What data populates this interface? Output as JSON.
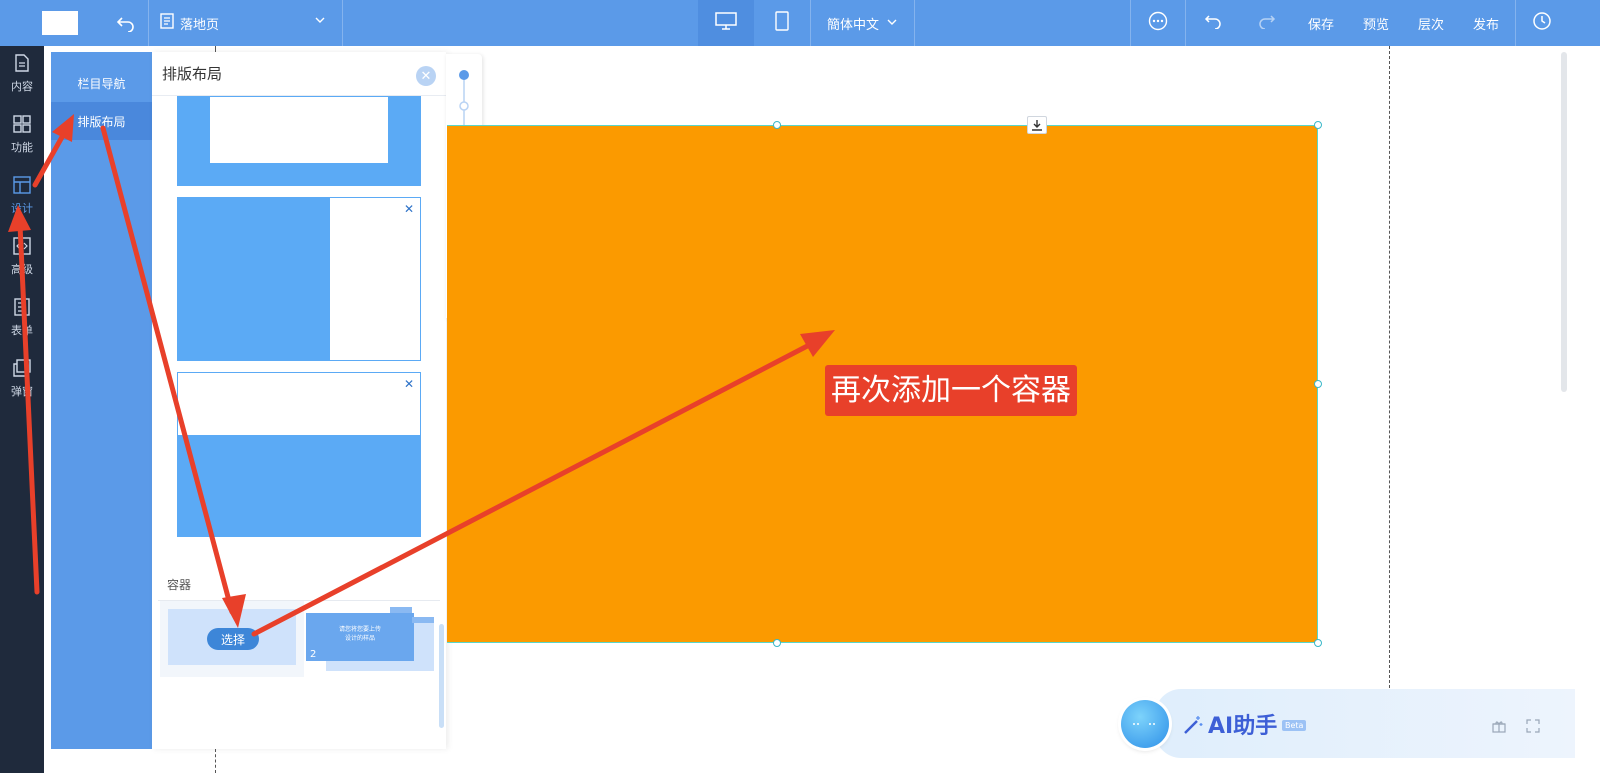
{
  "topbar": {
    "page_name": "落地页",
    "language": "簡体中文",
    "save": "保存",
    "preview": "预览",
    "layers": "层次",
    "publish": "发布"
  },
  "rail": {
    "items": [
      {
        "label": "内容",
        "icon": "document-icon"
      },
      {
        "label": "功能",
        "icon": "grid-icon"
      },
      {
        "label": "设计",
        "icon": "layout-icon"
      },
      {
        "label": "高级",
        "icon": "code-icon"
      },
      {
        "label": "表单",
        "icon": "form-icon"
      },
      {
        "label": "弹窗",
        "icon": "popup-icon"
      }
    ]
  },
  "panel": {
    "nav": [
      "栏目导航",
      "排版布局"
    ],
    "title": "排版布局",
    "section_title": "容器",
    "select_button": "选择",
    "card2_number": "2",
    "card2_text_line1": "请您将您要上传",
    "card2_text_line2": "设计的样品"
  },
  "canvas": {
    "annotation": "再次添加一个容器"
  },
  "ai": {
    "title": "AI助手",
    "badge": "Beta"
  },
  "colors": {
    "topbar": "#5b9ae8",
    "rail": "#1f2a3c",
    "orange_block": "#fb9a00",
    "annotation": "#e8402a"
  }
}
